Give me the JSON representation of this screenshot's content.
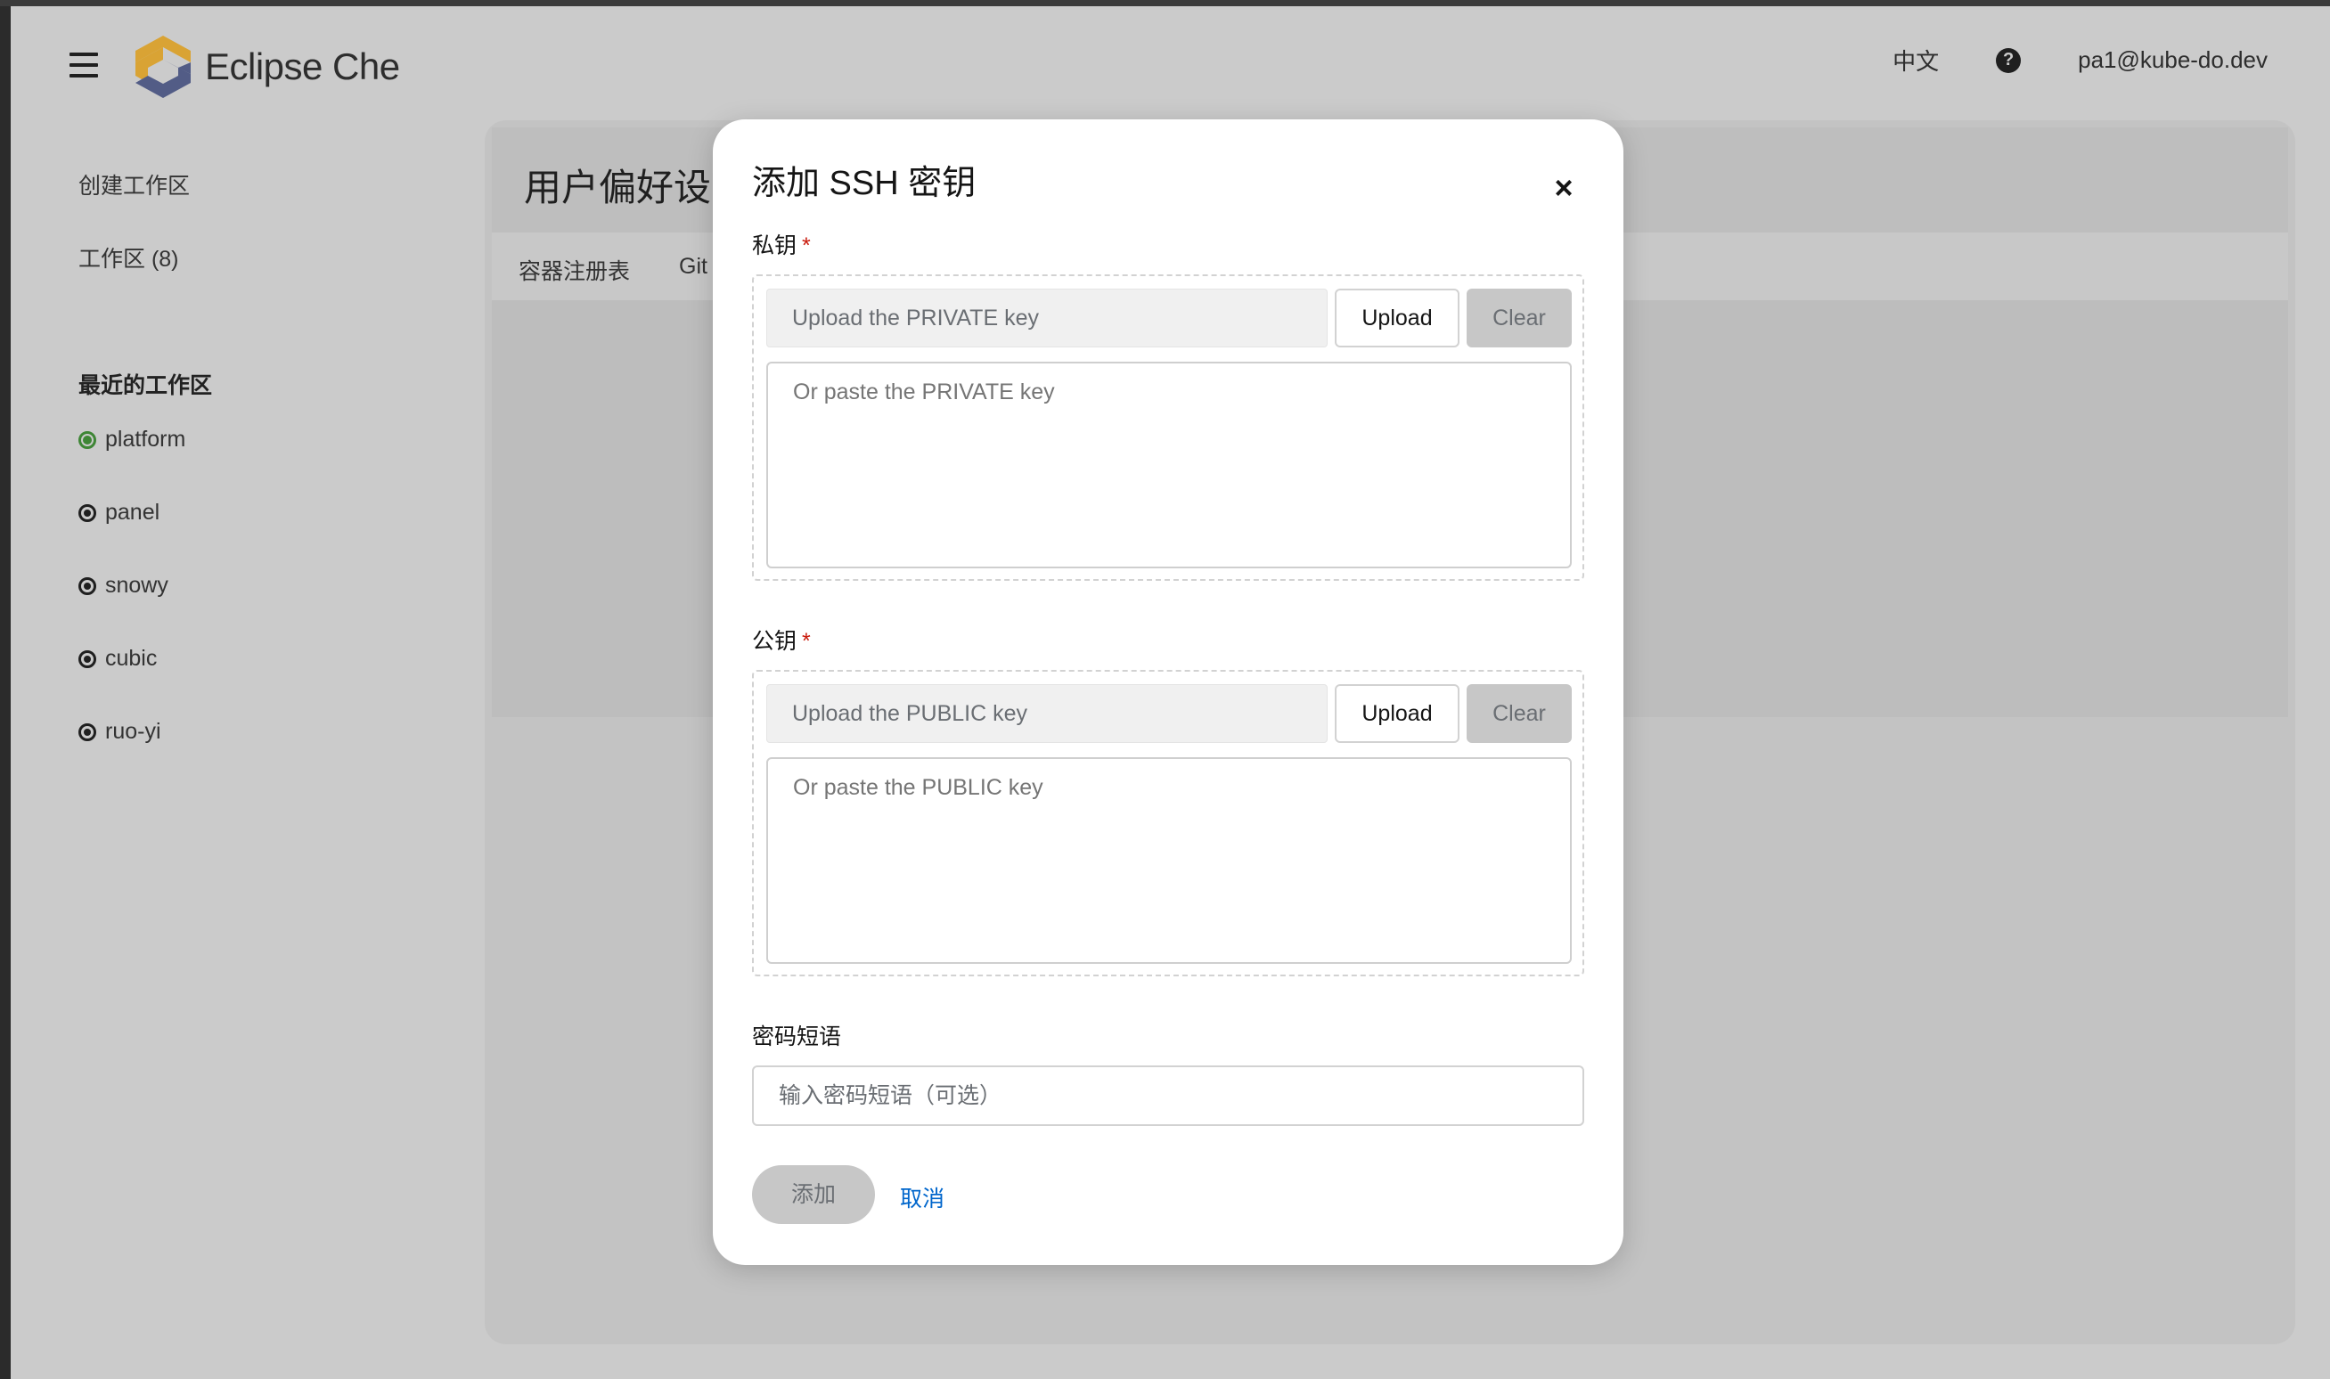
{
  "masthead": {
    "brand_name": "Eclipse Che",
    "language": "中文",
    "user": "pa1@kube-do.dev"
  },
  "sidebar": {
    "nav": [
      {
        "label": "创建工作区"
      },
      {
        "label": "工作区 (8)"
      }
    ],
    "recent_title": "最近的工作区",
    "recent": [
      {
        "label": "platform",
        "status": "running"
      },
      {
        "label": "panel",
        "status": "stopped"
      },
      {
        "label": "snowy",
        "status": "stopped"
      },
      {
        "label": "cubic",
        "status": "stopped"
      },
      {
        "label": "ruo-yi",
        "status": "stopped"
      }
    ]
  },
  "page": {
    "title": "用户偏好设",
    "tabs": [
      {
        "label": "容器注册表"
      },
      {
        "label": "Git"
      }
    ]
  },
  "modal": {
    "title": "添加 SSH 密钥",
    "close_symbol": "×",
    "private_key": {
      "label": "私钥",
      "required_mark": "*",
      "filename_placeholder": "Upload the PRIVATE key",
      "upload_label": "Upload",
      "clear_label": "Clear",
      "paste_placeholder": "Or paste the PRIVATE key"
    },
    "public_key": {
      "label": "公钥",
      "required_mark": "*",
      "filename_placeholder": "Upload the PUBLIC key",
      "upload_label": "Upload",
      "clear_label": "Clear",
      "paste_placeholder": "Or paste the PUBLIC key"
    },
    "passphrase": {
      "label": "密码短语",
      "placeholder": "输入密码短语（可选）"
    },
    "add_label": "添加",
    "cancel_label": "取消"
  },
  "colors": {
    "accent_link": "#0066cc",
    "required": "#c9190b",
    "running": "#3e8635"
  }
}
